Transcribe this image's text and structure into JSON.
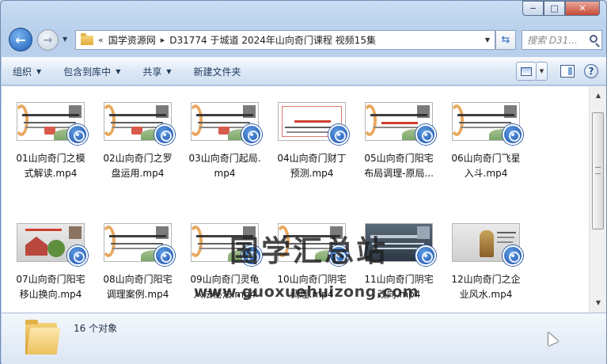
{
  "window": {
    "caption_min": "−",
    "caption_max": "□",
    "caption_close": "✕"
  },
  "nav": {
    "back_glyph": "←",
    "forward_glyph": "→",
    "history_drop": "▼",
    "breadcrumb_lead": "«",
    "breadcrumb": [
      "国学资源网",
      "D31774 于城道 2024年山向奇门课程 视频15集"
    ],
    "breadcrumb_sep": "▸",
    "address_drop": "▼",
    "refresh_glyph": "⇆",
    "search_placeholder": "搜索 D31..."
  },
  "toolbar": {
    "items": [
      {
        "label": "组织",
        "caret": "▼"
      },
      {
        "label": "包含到库中",
        "caret": "▼"
      },
      {
        "label": "共享",
        "caret": "▼"
      },
      {
        "label": "新建文件夹",
        "caret": ""
      }
    ],
    "view_drop": "▼",
    "help": "?"
  },
  "files": [
    {
      "name": "01山向奇门之模式解读.mp4",
      "thumb_style": "scroll"
    },
    {
      "name": "02山向奇门之罗盘运用.mp4",
      "thumb_style": "scroll"
    },
    {
      "name": "03山向奇门起局.mp4",
      "thumb_style": "scroll"
    },
    {
      "name": "04山向奇门财丁预测.mp4",
      "thumb_style": "frame"
    },
    {
      "name": "05山向奇门阳宅布局调理-原局...",
      "thumb_style": "scroll"
    },
    {
      "name": "06山向奇门飞星入斗.mp4",
      "thumb_style": "scroll"
    },
    {
      "name": "07山向奇门阳宅移山换向.mp4",
      "thumb_style": "photo-house"
    },
    {
      "name": "08山向奇门阳宅调理案例.mp4",
      "thumb_style": "scroll"
    },
    {
      "name": "09山向奇门灵龟八法秘法.mp4",
      "thumb_style": "scroll"
    },
    {
      "name": "10山向奇门阴宅调理.mp4",
      "thumb_style": "scroll"
    },
    {
      "name": "11山向奇门阴宅改向.mp4",
      "thumb_style": "dark"
    },
    {
      "name": "12山向奇门之企业风水.mp4",
      "thumb_style": "photo-figure"
    }
  ],
  "watermark": {
    "title": "国学汇总站",
    "url": "www.guoxuehuizong.com"
  },
  "status": {
    "count_text": "16 个对象"
  },
  "colors": {
    "accent": "#1f5fb7",
    "toolbar_text": "#1e395b"
  }
}
